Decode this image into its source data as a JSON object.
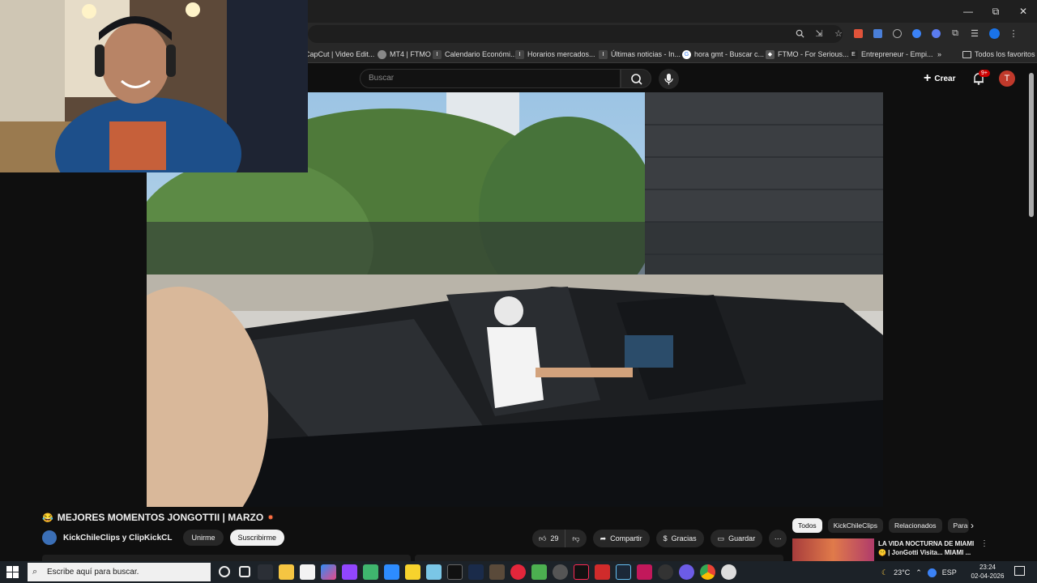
{
  "window": {
    "minimize": "—",
    "maximize": "⧉",
    "close": "✕"
  },
  "bookmarks": [
    {
      "icon": "capcut-icon",
      "label": "CapCut | Video Edit..."
    },
    {
      "icon": "globe-icon",
      "label": "MT4 | FTMO"
    },
    {
      "icon": "investing-icon",
      "label": "Calendario Económi..."
    },
    {
      "icon": "investing-icon",
      "label": "Horarios mercados..."
    },
    {
      "icon": "investing-icon",
      "label": "Últimas noticias - In..."
    },
    {
      "icon": "google-icon",
      "label": "hora gmt - Buscar c..."
    },
    {
      "icon": "ftmo-icon",
      "label": "FTMO - For Serious..."
    },
    {
      "icon": "entrepreneur-icon",
      "label": "Entrepreneur - Empi..."
    }
  ],
  "bookmarks_more": "»",
  "bookmarks_folder": "Todos los favoritos",
  "header": {
    "search_placeholder": "Buscar",
    "create_label": "Crear",
    "notifications_badge": "9+",
    "avatar_letter": "T"
  },
  "video": {
    "title": "MEJORES MOMENTOS JONGOTTII | MARZO",
    "channel": "KickChileClips y ClipKickCL",
    "join_label": "Unirme",
    "subscribe_label": "Suscribirme",
    "likes": "29",
    "share_label": "Compartir",
    "thanks_label": "Gracias",
    "save_label": "Guardar",
    "more_label": "⋯"
  },
  "chips": [
    "Todos",
    "KickChileClips",
    "Relacionados",
    "Para"
  ],
  "recommendation": {
    "title": "LA VIDA NOCTURNA DE MIAMI 🤫 | JonGotti Visita... MIAMI ..."
  },
  "taskbar": {
    "search_placeholder": "Escribe aquí para buscar.",
    "weather": "23°C",
    "language": "ESP",
    "time": "23:24",
    "date": "02-04-2026"
  },
  "colors": {
    "background": "#0f0f0f",
    "accent_red": "#cc0000",
    "taskbar": "#1c2228"
  }
}
